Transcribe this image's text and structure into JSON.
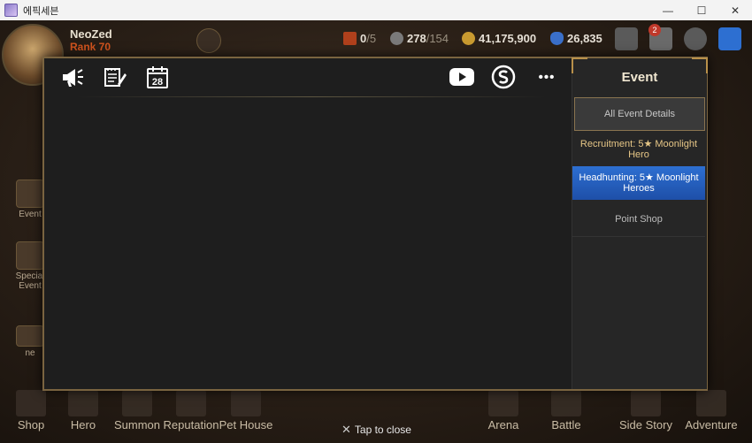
{
  "window": {
    "title": "에픽세븐",
    "controls": [
      "—",
      "☐",
      "✕"
    ]
  },
  "player": {
    "name": "NeoZed",
    "rank": "Rank 70"
  },
  "resources": {
    "stamina_current": "0",
    "stamina_max": "/5",
    "skystone_current": "278",
    "skystone_max": "/154",
    "gold": "41,175,900",
    "crystals": "26,835"
  },
  "mail_badge": "2",
  "sidebar": {
    "items": [
      {
        "label": "Event"
      },
      {
        "label": "Special Event"
      },
      {
        "label": "ne"
      }
    ]
  },
  "bottom_nav": {
    "items": [
      {
        "label": "Shop"
      },
      {
        "label": "Hero"
      },
      {
        "label": "Summon"
      },
      {
        "label": "Reputation"
      },
      {
        "label": "Pet House"
      },
      {
        "label": "Arena"
      },
      {
        "label": "Battle"
      },
      {
        "label": "Side Story"
      },
      {
        "label": "Adventure"
      }
    ]
  },
  "panel": {
    "header_icons": [
      "megaphone-icon",
      "notes-icon",
      "calendar-icon",
      "youtube-icon",
      "stove-icon",
      "more-icon"
    ],
    "calendar_day": "28",
    "more_label": "•••",
    "event_column": {
      "title": "Event",
      "items": [
        {
          "label": "All Event Details"
        },
        {
          "label": "Recruitment: 5★ Moonlight Hero"
        },
        {
          "label": "Headhunting: 5★ Moonlight Heroes"
        },
        {
          "label": "Point Shop"
        }
      ]
    }
  },
  "tap_to_close": "Tap to close",
  "colors": {
    "panel_border": "#7a6440",
    "selected_event": "#2d6fd1",
    "recruit_text": "#e6c686",
    "rank_text": "#d2541e"
  }
}
